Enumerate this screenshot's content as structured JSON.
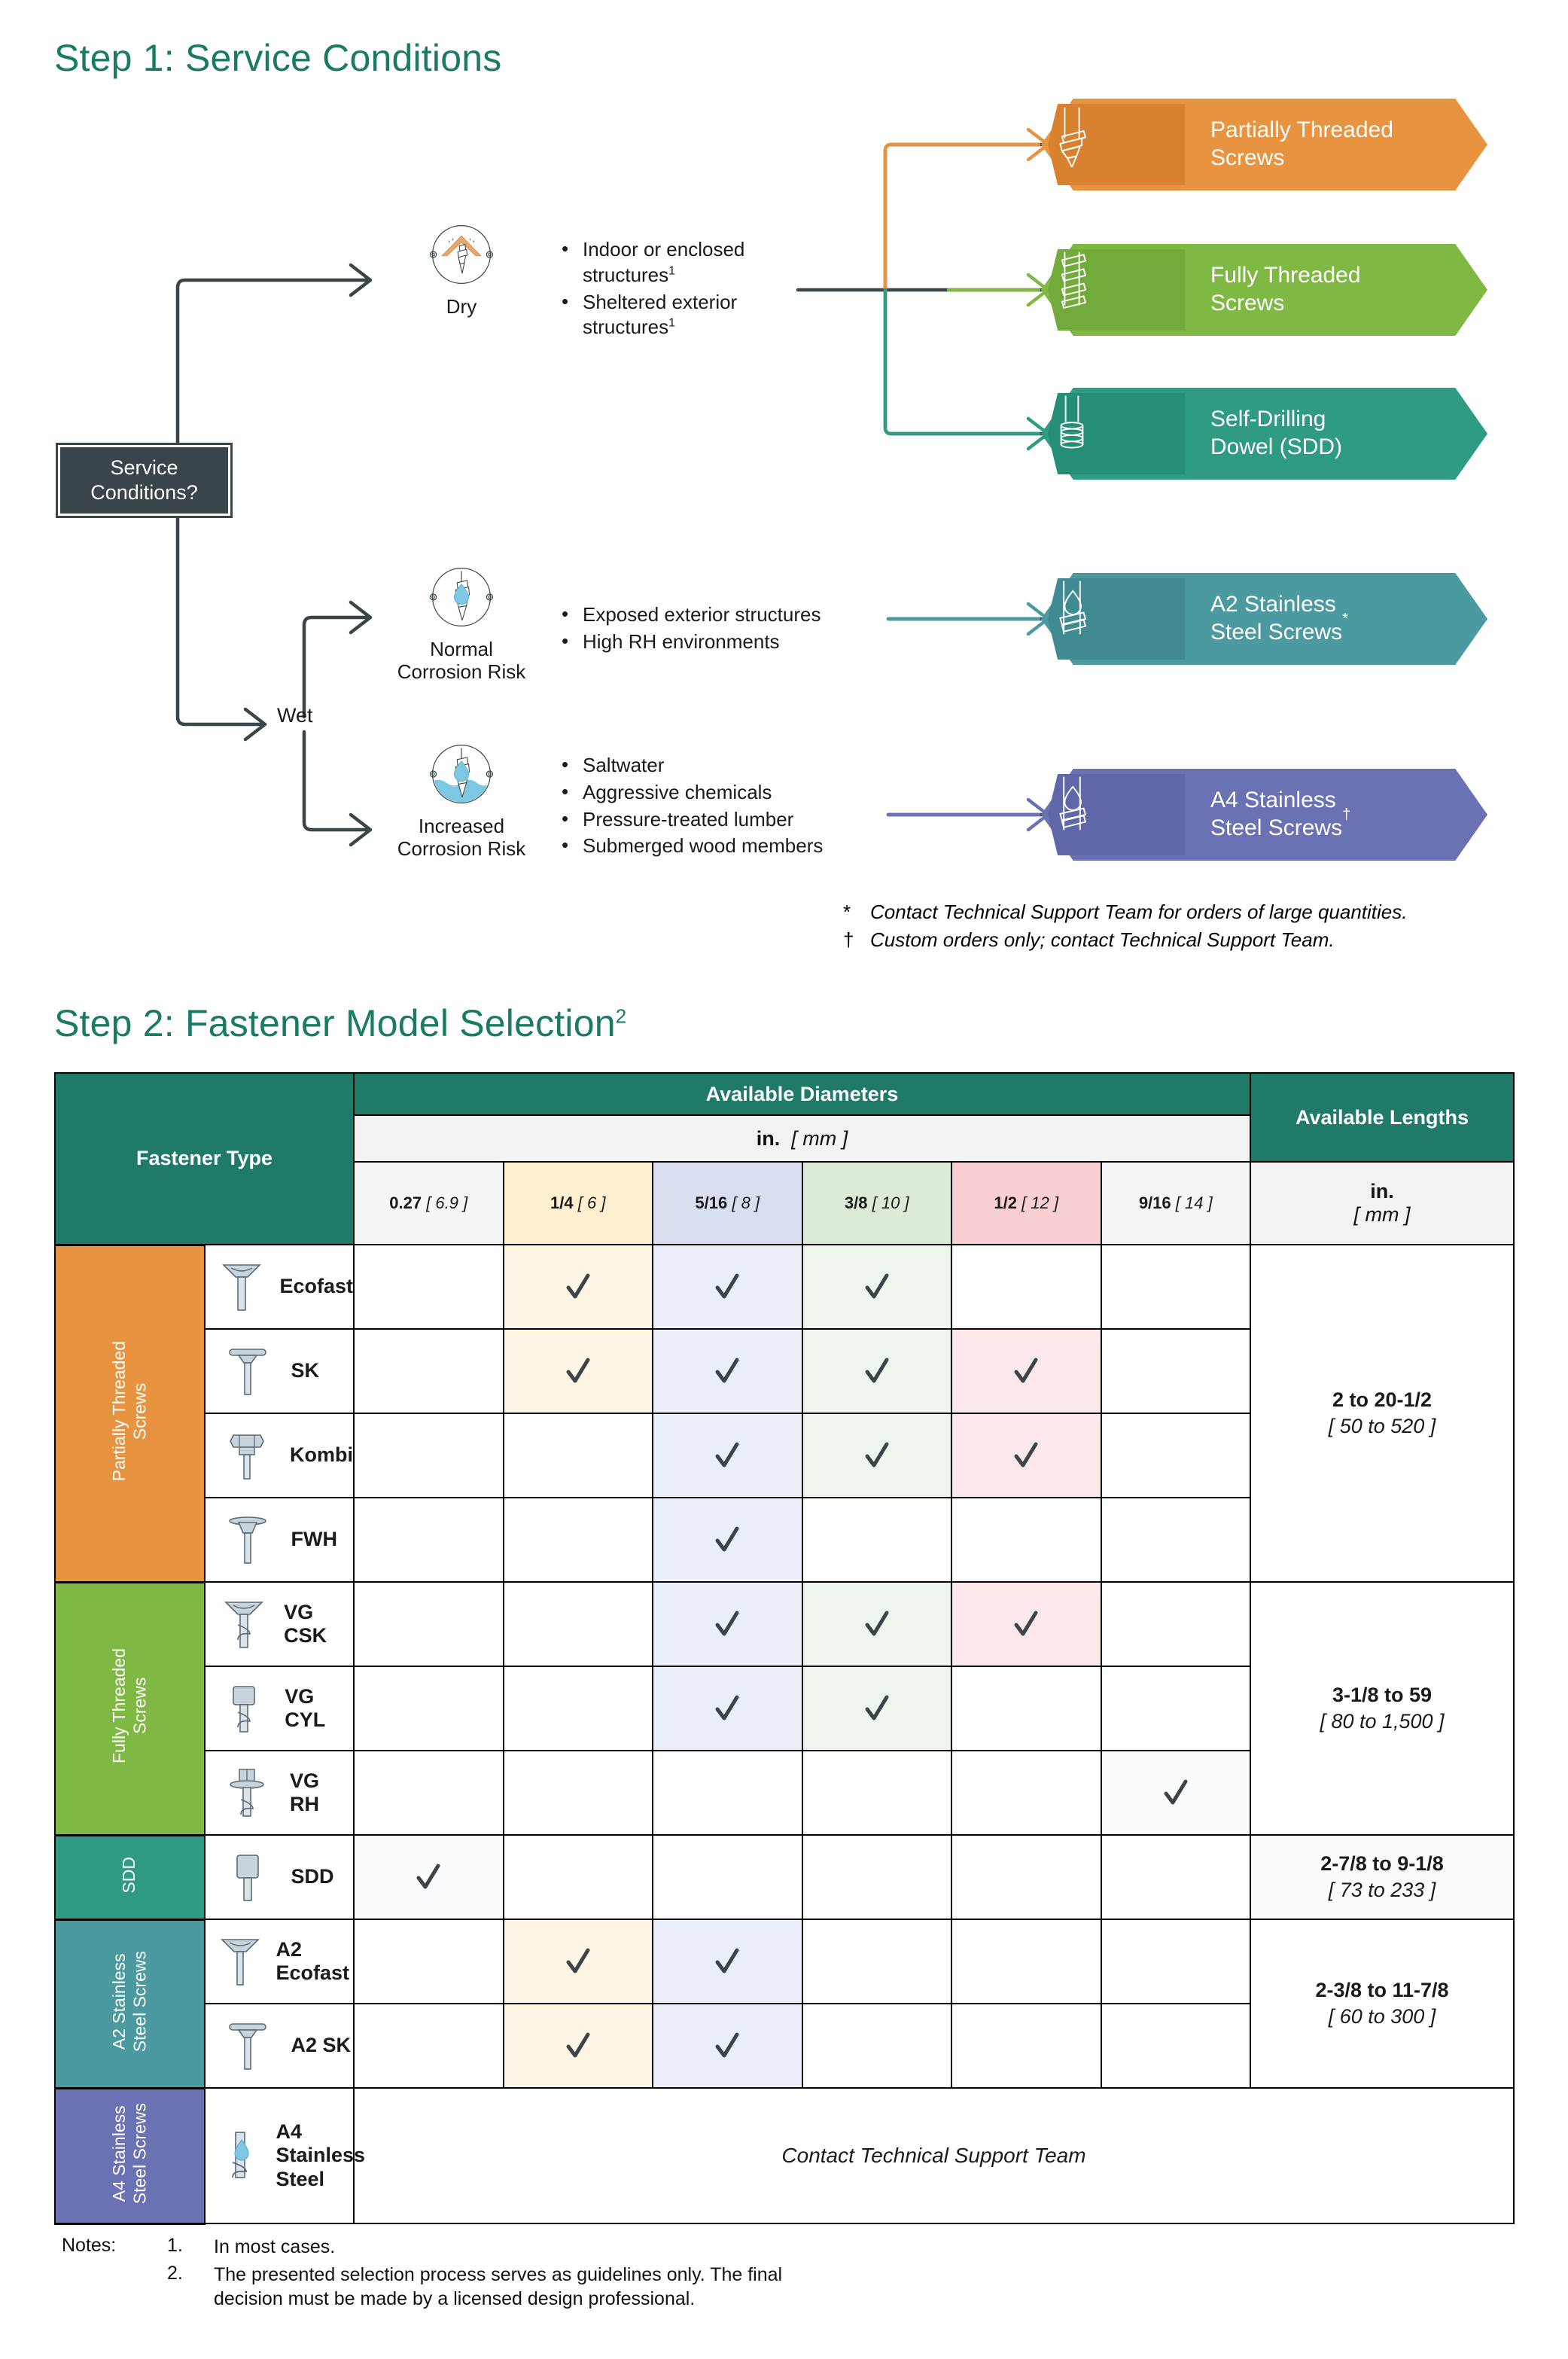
{
  "step1": {
    "heading": "Step 1: Service Conditions",
    "decision_box": "Service\nConditions?",
    "branch_labels": {
      "wet": "Wet"
    },
    "conditions": [
      {
        "id": "dry",
        "caption": "Dry",
        "icon": "roof-rain-screw-icon",
        "bullets": [
          "Indoor or enclosed structures",
          "Sheltered exterior structures"
        ],
        "bullet_marks": [
          "1",
          "1"
        ]
      },
      {
        "id": "normal",
        "caption": "Normal\nCorrosion Risk",
        "icon": "water-drop-screw-icon",
        "bullets": [
          "Exposed exterior structures",
          "High RH environments"
        ],
        "bullet_marks": [
          "",
          ""
        ]
      },
      {
        "id": "increased",
        "caption": "Increased\nCorrosion Risk",
        "icon": "submerged-screw-icon",
        "bullets": [
          "Saltwater",
          "Aggressive chemicals",
          "Pressure-treated lumber",
          "Submerged wood members"
        ],
        "bullet_marks": [
          "",
          "",
          "",
          ""
        ]
      }
    ],
    "outcomes": [
      {
        "id": "partially-threaded",
        "label": "Partially Threaded\nScrews",
        "mark": "",
        "fill": "#E8933F",
        "dark": "#D8822F",
        "stroke": "#E8933F",
        "icon": "partially-threaded-screw-icon"
      },
      {
        "id": "fully-threaded",
        "label": "Fully Threaded\nScrews",
        "mark": "",
        "fill": "#7FB944",
        "dark": "#72AA3C",
        "stroke": "#7FB944",
        "icon": "fully-threaded-screw-icon"
      },
      {
        "id": "self-drilling-dowel",
        "label": "Self-Drilling\nDowel (SDD)",
        "mark": "",
        "fill": "#2E9B82",
        "dark": "#278E76",
        "stroke": "#2E9B82",
        "icon": "self-drilling-dowel-icon"
      },
      {
        "id": "a2-stainless",
        "label": "A2 Stainless\nSteel Screws",
        "mark": "*",
        "fill": "#4A9AA0",
        "dark": "#3F8B91",
        "stroke": "#4A9AA0",
        "icon": "a2-stainless-screw-icon"
      },
      {
        "id": "a4-stainless",
        "label": "A4 Stainless\nSteel Screws",
        "mark": "†",
        "fill": "#6A72B3",
        "dark": "#5F67A8",
        "stroke": "#6A72B3",
        "icon": "a4-stainless-screw-icon"
      }
    ],
    "footnotes": [
      {
        "mark": "*",
        "text": "Contact Technical Support Team for orders of large quantities."
      },
      {
        "mark": "†",
        "text": "Custom orders only; contact Technical Support Team."
      }
    ]
  },
  "step2": {
    "heading": "Step 2: Fastener Model Selection",
    "heading_sup": "2",
    "table": {
      "headers": {
        "fastener_type": "Fastener Type",
        "available_diameters": "Available Diameters",
        "available_lengths": "Available Lengths",
        "diameter_units": "in. [ mm ]",
        "diameter_units_in": "in.",
        "diameter_units_mm": "[ mm ]",
        "length_units_in": "in.",
        "length_units_mm": "[ mm ]"
      },
      "diameter_columns": [
        {
          "label_in": "0.27",
          "label_mm": "[ 6.9 ]",
          "color": "#F4F5F7"
        },
        {
          "label_in": "1/4",
          "label_mm": "[ 6 ]",
          "color": "#FDEFCF"
        },
        {
          "label_in": "5/16",
          "label_mm": "[ 8 ]",
          "color": "#D9DFF1"
        },
        {
          "label_in": "3/8",
          "label_mm": "[ 10 ]",
          "color": "#DCEBD8"
        },
        {
          "label_in": "1/2",
          "label_mm": "[ 12 ]",
          "color": "#F9CFD3"
        },
        {
          "label_in": "9/16",
          "label_mm": "[ 14 ]",
          "color": "#F4F5F7"
        }
      ],
      "cell_tints": [
        "#FAFBFC",
        "#FEF6E4",
        "#EBEFF9",
        "#EEF5EC",
        "#FCE8EA",
        "#FAFBFC"
      ],
      "groups": [
        {
          "id": "partially-threaded",
          "label": "Partially Threaded\nScrews",
          "color": "#E8933F",
          "length_in": "2 to 20-1/2",
          "length_mm": "[ 50 to 520 ]",
          "rows": [
            {
              "name": "Ecofast",
              "icon": "countersunk-screw-icon",
              "checks": [
                false,
                true,
                true,
                true,
                false,
                false
              ]
            },
            {
              "name": "SK",
              "icon": "flat-head-screw-icon",
              "checks": [
                false,
                true,
                true,
                true,
                true,
                false
              ]
            },
            {
              "name": "Kombi",
              "icon": "hex-head-screw-icon",
              "checks": [
                false,
                false,
                true,
                true,
                true,
                false
              ]
            },
            {
              "name": "FWH",
              "icon": "washer-head-screw-icon",
              "checks": [
                false,
                false,
                true,
                false,
                false,
                false
              ]
            }
          ]
        },
        {
          "id": "fully-threaded",
          "label": "Fully Threaded\nScrews",
          "color": "#7FB944",
          "length_in": "3-1/8 to 59",
          "length_mm": "[ 80 to 1,500 ]",
          "rows": [
            {
              "name": "VG CSK",
              "icon": "vg-countersunk-screw-icon",
              "checks": [
                false,
                false,
                true,
                true,
                true,
                false
              ]
            },
            {
              "name": "VG CYL",
              "icon": "vg-cylinder-screw-icon",
              "checks": [
                false,
                false,
                true,
                true,
                false,
                false
              ]
            },
            {
              "name": "VG RH",
              "icon": "vg-round-head-screw-icon",
              "checks": [
                false,
                false,
                false,
                false,
                false,
                true
              ]
            }
          ]
        },
        {
          "id": "sdd",
          "label": "SDD",
          "color": "#2E9B82",
          "length_in": "2-7/8 to 9-1/8",
          "length_mm": "[ 73 to 233 ]",
          "rows": [
            {
              "name": "SDD",
              "icon": "sdd-dowel-icon",
              "checks": [
                true,
                false,
                false,
                false,
                false,
                false
              ]
            }
          ]
        },
        {
          "id": "a2-stainless",
          "label": "A2 Stainless\nSteel Screws",
          "color": "#4A9AA0",
          "length_in": "2-3/8 to 11-7/8",
          "length_mm": "[ 60 to 300 ]",
          "rows": [
            {
              "name": "A2 Ecofast",
              "icon": "a2-countersunk-screw-icon",
              "checks": [
                false,
                true,
                true,
                false,
                false,
                false
              ]
            },
            {
              "name": "A2 SK",
              "icon": "a2-flat-head-screw-icon",
              "checks": [
                false,
                true,
                true,
                false,
                false,
                false
              ]
            }
          ]
        },
        {
          "id": "a4-stainless",
          "label": "A4 Stainless\nSteel Screws",
          "color": "#6A72B3",
          "rows": [
            {
              "name": "A4 Stainless\nSteel",
              "icon": "a4-stainless-screw-icon",
              "merged_text": "Contact Technical Support Team"
            }
          ]
        }
      ]
    }
  },
  "notes": {
    "label": "Notes:",
    "items": [
      {
        "num": "1.",
        "text": "In most cases."
      },
      {
        "num": "2.",
        "text": "The presented selection process serves as guidelines only. The final decision must be made by a licensed design professional."
      }
    ]
  },
  "colors": {
    "brand_teal": "#1a7a64",
    "table_header_green": "#1f7a68",
    "decision_dark": "#394548",
    "connector": "#394548"
  }
}
